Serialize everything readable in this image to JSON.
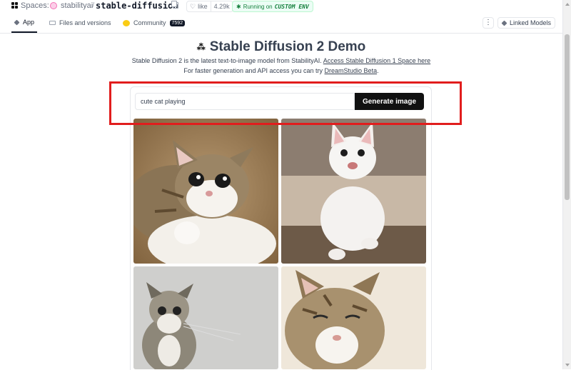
{
  "header": {
    "spaces_label": "Spaces:",
    "org": "stabilityai",
    "separator": "/",
    "space": "stable-diffusion",
    "like_label": "like",
    "like_count": "4.29k",
    "status_prefix": "Running on",
    "status_env": "CUSTOM ENV"
  },
  "tabs": [
    {
      "label": "App",
      "icon": "cube-icon",
      "active": true
    },
    {
      "label": "Files and versions",
      "icon": "file-icon"
    },
    {
      "label": "Community",
      "icon": "community-icon",
      "count": "7592"
    }
  ],
  "toolbar": {
    "more_label": "⋮",
    "linked_models_label": "Linked Models"
  },
  "main": {
    "title": "Stable Diffusion 2 Demo",
    "desc1_text": "Stable Diffusion 2 is the latest text-to-image model from StabilityAI.",
    "desc1_link": "Access Stable Diffusion 1 Space here",
    "desc2_text": "For faster generation and API access you can try",
    "desc2_link": "DreamStudio Beta",
    "desc2_end": "."
  },
  "prompt": {
    "value": "cute cat playing",
    "button_label": "Generate image"
  },
  "gallery": [
    {
      "subject": "tabby kitten crouching on carpet"
    },
    {
      "subject": "white kitten running"
    },
    {
      "subject": "grey tabby kitten sitting"
    },
    {
      "subject": "tabby kitten with eyes closed"
    }
  ],
  "colors": {
    "highlight": "#e11d1d",
    "status_green": "#15803d",
    "button_bg": "#111111"
  }
}
